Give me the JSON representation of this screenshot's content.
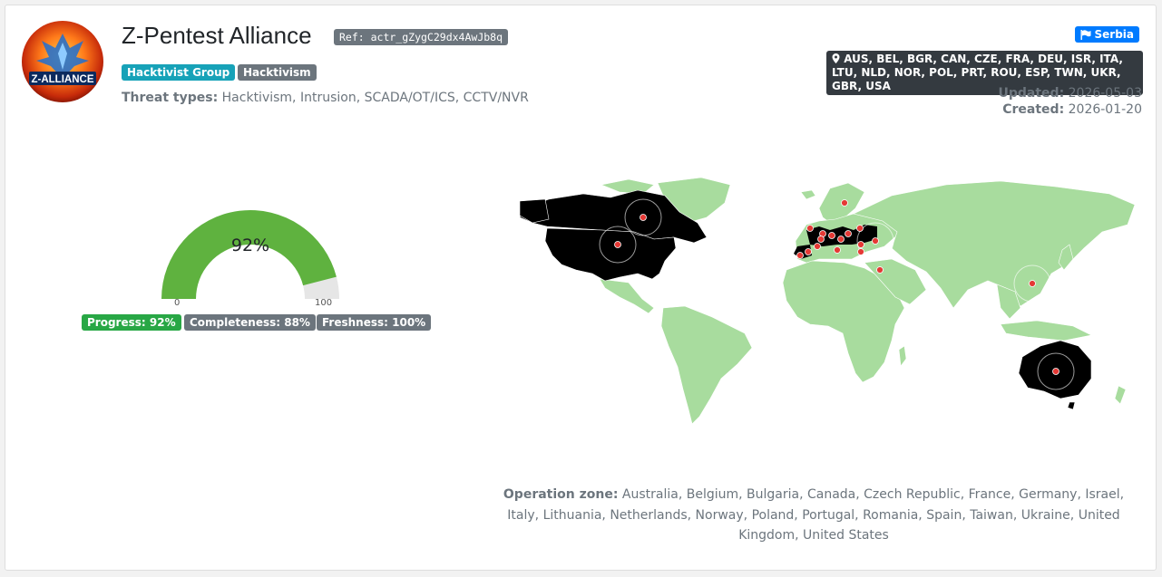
{
  "actor": {
    "name": "Z-Pentest Alliance",
    "ref": "Ref: actr_gZygC29dx4AwJb8q",
    "avatar_text": "Z-ALLIANCE",
    "tags": [
      "Hacktivist Group",
      "Hacktivism"
    ],
    "threat_label": "Threat types:",
    "threat_value": "Hacktivism, Intrusion, SCADA/OT/ICS, CCTV/NVR",
    "country": "Serbia",
    "target_codes": "AUS, BEL, BGR, CAN, CZE, FRA, DEU, ISR, ITA, LTU, NLD, NOR, POL, PRT, ROU, ESP, TWN, UKR, GBR, USA",
    "updated_label": "Updated:",
    "updated": "2026-05-03",
    "created_label": "Created:",
    "created": "2026-01-20"
  },
  "gauge": {
    "value": 92,
    "value_label": "92%",
    "min_label": "0",
    "max_label": "100",
    "fill_color": "#5fb23f",
    "track_color": "#e6e6e6"
  },
  "metrics": {
    "progress": "Progress: 92%",
    "completeness": "Completeness: 88%",
    "freshness": "Freshness: 100%"
  },
  "map": {
    "land_color": "#a8dc9e",
    "targeted_color": "#000000",
    "marker_color": "#e53935"
  },
  "operation_zone": {
    "label": "Operation zone:",
    "value": "Australia, Belgium, Bulgaria, Canada, Czech Republic, France, Germany, Israel, Italy, Lithuania, Netherlands, Norway, Poland, Portugal, Romania, Spain, Taiwan, Ukraine, United Kingdom, United States"
  }
}
